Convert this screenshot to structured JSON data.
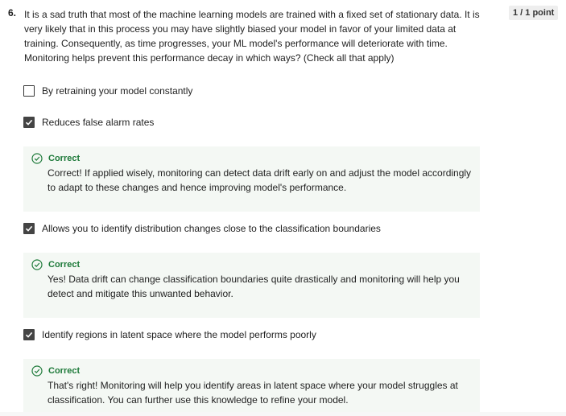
{
  "question": {
    "number": "6.",
    "text": "It is a sad truth that most of the machine learning models are trained with a fixed set of stationary data. It is very likely that in this process you may have slightly biased your model in favor of your limited data at training. Consequently, as time progresses, your ML model's performance will deteriorate with time. Monitoring helps prevent this performance decay in which ways? (Check all that apply)",
    "points": "1 / 1 point"
  },
  "options": [
    {
      "label": "By retraining your model constantly",
      "checked": false
    },
    {
      "label": "Reduces false alarm rates",
      "checked": true,
      "feedback": {
        "title": "Correct",
        "text": "Correct! If applied wisely, monitoring can detect data drift early on and adjust the model accordingly to adapt to these changes and hence improving model's performance."
      }
    },
    {
      "label": "Allows you to identify distribution changes close to the classification boundaries",
      "checked": true,
      "feedback": {
        "title": "Correct",
        "text": "Yes! Data drift can change classification boundaries quite drastically and monitoring will help you detect and mitigate this unwanted behavior."
      }
    },
    {
      "label": "Identify regions in latent space where the model performs poorly",
      "checked": true,
      "feedback": {
        "title": "Correct",
        "text": "That's right! Monitoring will help you identify areas in latent space where your model struggles at classification. You can further use this knowledge to refine your model."
      }
    }
  ],
  "icons": {
    "correct": "check-circle-icon",
    "checkbox_checked": "check-icon"
  },
  "colors": {
    "correct_green": "#1e7a3a",
    "feedback_bg": "#f4f8f4",
    "checkbox_checked": "#444444"
  }
}
